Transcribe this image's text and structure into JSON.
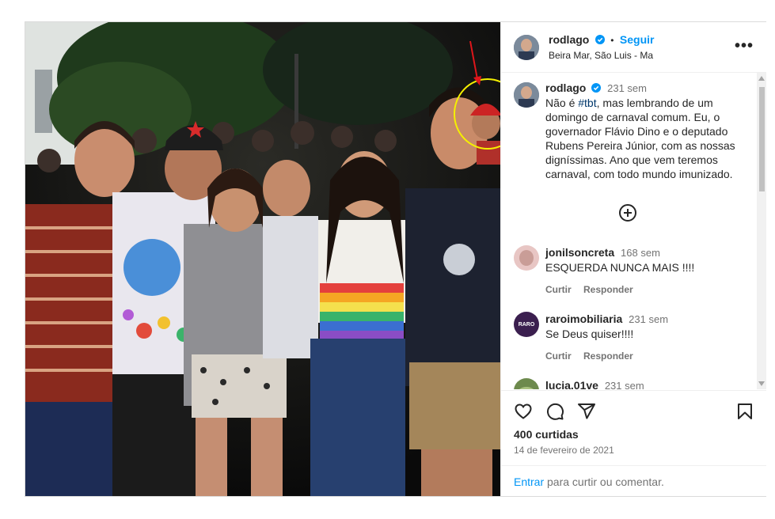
{
  "post": {
    "username": "rodlago",
    "follow_label": "Seguir",
    "separator": "•",
    "location": "Beira Mar, São Luis - Ma",
    "more_label": "•••",
    "caption_username": "rodlago",
    "caption_time": "231 sem",
    "caption_prefix": "Não é",
    "caption_hashtag": "#tbt",
    "caption_rest": ", mas lembrando de um domingo de carnaval comum. Eu, o governador Flávio Dino e o deputado Rubens Pereira Júnior, com as nossas digníssimas. Ano que vem teremos carnaval, com todo mundo imunizado.",
    "likes": "400 curtidas",
    "date": "14 de fevereiro de 2021",
    "login_link": "Entrar",
    "login_rest": " para curtir ou comentar."
  },
  "comments": [
    {
      "username": "jonilsoncreta",
      "time": "168 sem",
      "text": "ESQUERDA NUNCA MAIS !!!!",
      "like_label": "Curtir",
      "reply_label": "Responder"
    },
    {
      "username": "raroimobiliaria",
      "time": "231 sem",
      "text": "Se Deus quiser!!!!",
      "like_label": "Curtir",
      "reply_label": "Responder",
      "avatar_text": "RARO"
    },
    {
      "username": "lucia.01ve",
      "time": "231 sem"
    }
  ],
  "icons": [
    "heart-icon",
    "comment-icon",
    "share-icon",
    "bookmark-icon",
    "add-circle-icon",
    "verified-icon",
    "more-icon"
  ],
  "colors": {
    "accent": "#0095f6",
    "text": "#262626",
    "muted": "#737373",
    "annotation_circle": "#f5f000",
    "annotation_arrow": "#e0161b"
  }
}
